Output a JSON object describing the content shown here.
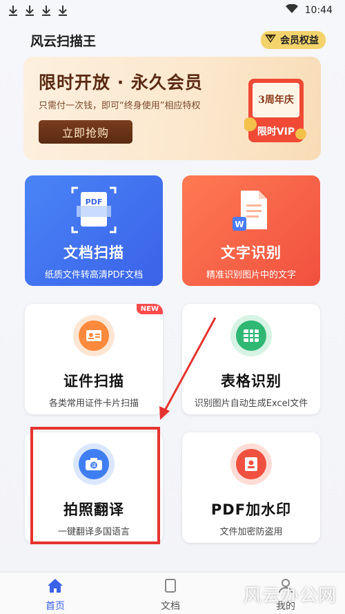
{
  "status_bar": {
    "time": "10:44"
  },
  "header": {
    "app_title": "风云扫描王",
    "member_label": "会员权益"
  },
  "banner": {
    "title": "限时开放 · 永久会员",
    "subtitle": "只需付一次钱，即可“终身使用”相应特权",
    "button": "立即抢购",
    "badge_top": "3周年庆",
    "badge_bottom": "限时VIP"
  },
  "cards": [
    {
      "title": "文档扫描",
      "subtitle": "纸质文件转高清PDF文档",
      "icon_text": "PDF"
    },
    {
      "title": "文字识别",
      "subtitle": "精准识别图片中的文字",
      "icon_text": "W"
    },
    {
      "title": "证件扫描",
      "subtitle": "各类常用证件卡片扫描",
      "tag": "NEW"
    },
    {
      "title": "表格识别",
      "subtitle": "识别图片自动生成Excel文件"
    },
    {
      "title": "拍照翻译",
      "subtitle": "一键翻译多国语言"
    },
    {
      "title": "PDF加水印",
      "subtitle": "文件加密防盗用"
    }
  ],
  "tabs": [
    {
      "label": "首页"
    },
    {
      "label": "文档"
    },
    {
      "label": "我的"
    }
  ],
  "watermark": "风云办公网",
  "colors": {
    "accent_blue": "#3a62e8",
    "accent_orange": "#f0503f",
    "highlight_red": "#e5332f"
  }
}
